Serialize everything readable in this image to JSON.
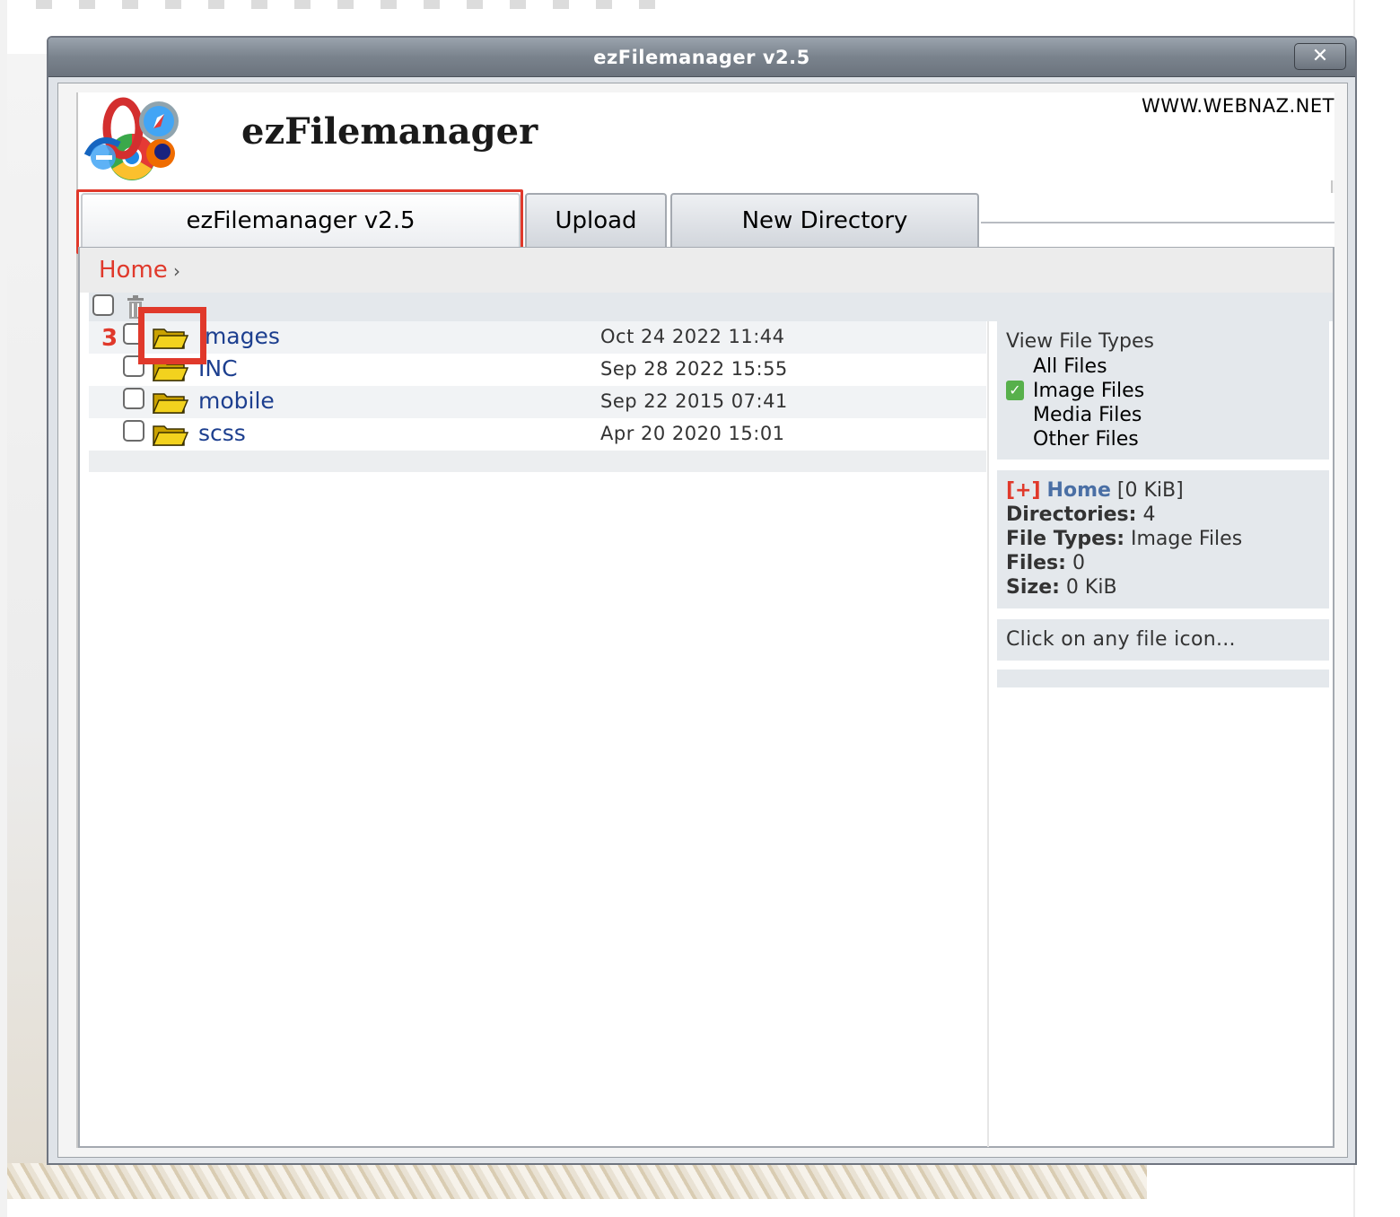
{
  "window": {
    "title": "ezFilemanager v2.5",
    "close_label": "✕"
  },
  "header": {
    "brand": "ezFilemanager",
    "site_url": "WWW.WEBNAZ.NET"
  },
  "tabs": [
    {
      "label": "ezFilemanager v2.5",
      "active": true
    },
    {
      "label": "Upload",
      "active": false
    },
    {
      "label": "New Directory",
      "active": false
    }
  ],
  "breadcrumb": {
    "home": "Home",
    "separator": "›"
  },
  "annotation": {
    "step_number": "3",
    "color": "#e0392b"
  },
  "files": [
    {
      "name": "images",
      "date": "Oct 24 2022 11:44",
      "icon": "folder-icon"
    },
    {
      "name": "INC",
      "date": "Sep 28 2022 15:55",
      "icon": "folder-icon"
    },
    {
      "name": "mobile",
      "date": "Sep 22 2015 07:41",
      "icon": "folder-icon"
    },
    {
      "name": "scss",
      "date": "Apr 20 2020 15:01",
      "icon": "folder-icon"
    }
  ],
  "file_types": {
    "title": "View File Types",
    "options": [
      {
        "label": "All Files",
        "selected": false
      },
      {
        "label": "Image Files",
        "selected": true
      },
      {
        "label": "Media Files",
        "selected": false
      },
      {
        "label": "Other Files",
        "selected": false
      }
    ]
  },
  "summary": {
    "expand": "[+]",
    "home": "Home",
    "home_size": "[0 KiB]",
    "directories_label": "Directories:",
    "directories_value": "4",
    "file_types_label": "File Types:",
    "file_types_value": "Image Files",
    "files_label": "Files:",
    "files_value": "0",
    "size_label": "Size:",
    "size_value": "0 KiB"
  },
  "hint": "Click on any file icon...",
  "colors": {
    "accent_red": "#e0392b",
    "link_blue": "#1d3f8f",
    "titlebar": "#7a838d",
    "check_green": "#57b04b"
  }
}
